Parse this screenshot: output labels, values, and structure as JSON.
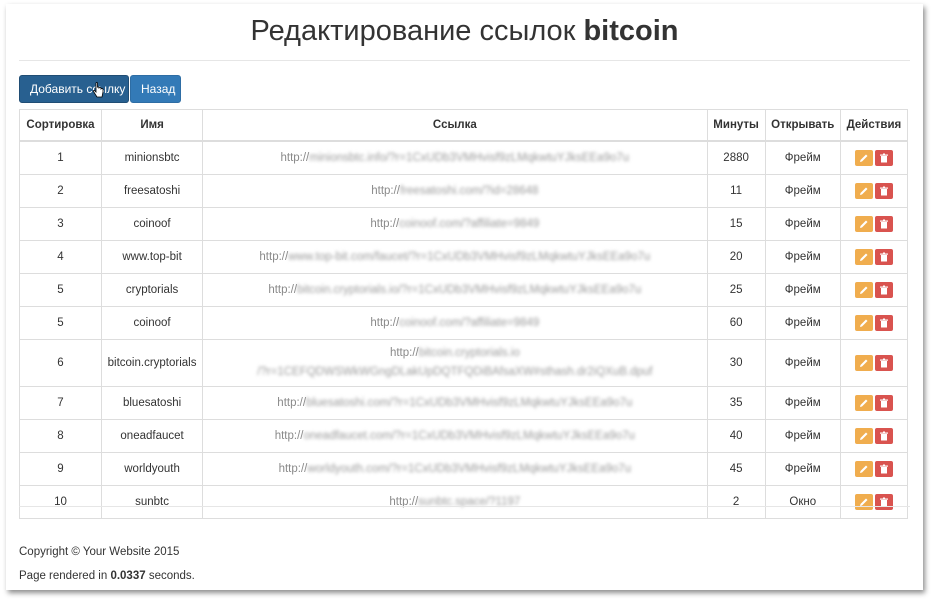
{
  "page": {
    "title_prefix": "Редактирование ссылок",
    "title_bold": "bitcoin"
  },
  "toolbar": {
    "add_label": "Добавить ссылку",
    "back_label": "Назад"
  },
  "table": {
    "headers": [
      "Сортировка",
      "Имя",
      "Ссылка",
      "Минуты",
      "Открывать",
      "Действия"
    ],
    "rows": [
      {
        "sort": "1",
        "name": "minionsbtc",
        "link_prefix": "http://",
        "link_rest": "minionsbtc.info/?r=1CxUDb3VMHvisf9zLMqkwtuYJksEEa9o7u",
        "minutes": "2880",
        "open": "Фрейм"
      },
      {
        "sort": "2",
        "name": "freesatoshi",
        "link_prefix": "http://",
        "link_rest": "freesatoshi.com/?id=28648",
        "minutes": "11",
        "open": "Фрейм"
      },
      {
        "sort": "3",
        "name": "coinoof",
        "link_prefix": "http://",
        "link_rest": "coinoof.com/?affiliate=9849",
        "minutes": "15",
        "open": "Фрейм"
      },
      {
        "sort": "4",
        "name": "www.top-bit",
        "link_prefix": "http://",
        "link_rest": "www.top-bit.com/faucet/?r=1CxUDb3VMHvisf9zLMqkwtuYJksEEa9o7u",
        "minutes": "20",
        "open": "Фрейм"
      },
      {
        "sort": "5",
        "name": "cryptorials",
        "link_prefix": "http://",
        "link_rest": "bitcoin.cryptorials.io/?r=1CxUDb3VMHvisf9zLMqkwtuYJksEEa9o7u",
        "minutes": "25",
        "open": "Фрейм"
      },
      {
        "sort": "5",
        "name": "coinoof",
        "link_prefix": "http://",
        "link_rest": "coinoof.com/?affiliate=9849",
        "minutes": "60",
        "open": "Фрейм"
      },
      {
        "sort": "6",
        "name": "bitcoin.cryptorials",
        "link_prefix": "http://",
        "link_rest": "bitcoin.cryptorials.io",
        "link_line2": "/?r=1CEFQDWSWkWGngDLakUpDQTFQDiBAfsaXW#sthash.dr2iQXuB.dpuf",
        "minutes": "30",
        "open": "Фрейм"
      },
      {
        "sort": "7",
        "name": "bluesatoshi",
        "link_prefix": "http://",
        "link_rest": "bluesatoshi.com/?r=1CxUDb3VMHvisf9zLMqkwtuYJksEEa9o7u",
        "minutes": "35",
        "open": "Фрейм"
      },
      {
        "sort": "8",
        "name": "oneadfaucet",
        "link_prefix": "http://",
        "link_rest": "oneadfaucet.com/?r=1CxUDb3VMHvisf9zLMqkwtuYJksEEa9o7u",
        "minutes": "40",
        "open": "Фрейм"
      },
      {
        "sort": "9",
        "name": "worldyouth",
        "link_prefix": "http://",
        "link_rest": "worldyouth.com/?r=1CxUDb3VMHvisf9zLMqkwtuYJksEEa9o7u",
        "minutes": "45",
        "open": "Фрейм"
      },
      {
        "sort": "10",
        "name": "sunbtc",
        "link_prefix": "http://",
        "link_rest": "sunbtc.space/?1197",
        "minutes": "2",
        "open": "Окно"
      }
    ]
  },
  "footer": {
    "copyright": "Copyright © Your Website 2015",
    "rendered_prefix": "Page rendered in",
    "rendered_value": "0.0337",
    "rendered_suffix": "seconds."
  },
  "colors": {
    "primary_dark": "#286090",
    "primary": "#337ab7",
    "warning": "#f0ad4e",
    "danger": "#d9534f"
  }
}
